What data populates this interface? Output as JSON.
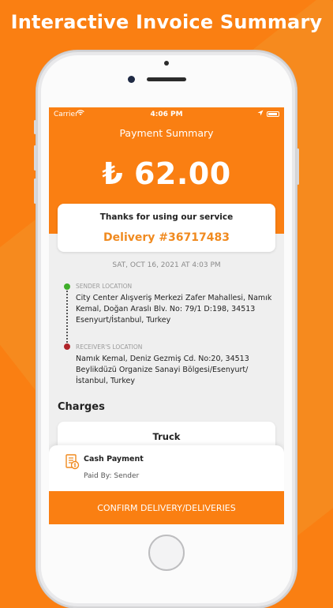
{
  "promo": {
    "title": "Interactive Invoice Summary"
  },
  "status_bar": {
    "carrier": "Carrier",
    "time": "4:06 PM"
  },
  "header": {
    "title": "Payment Summary",
    "amount": "₺ 62.00"
  },
  "thanks_card": {
    "message": "Thanks for using our service",
    "delivery_id": "Delivery #36717483"
  },
  "date": "SAT, OCT 16, 2021 AT 4:03 PM",
  "sender": {
    "label": "SENDER LOCATION",
    "address": "City Center Alışveriş Merkezi Zafer Mahallesi, Namık Kemal,  Doğan Araslı Blv. No: 79/1 D:198, 34513 Esenyurt/İstanbul,  Turkey"
  },
  "receiver": {
    "label": "RECEIVER'S LOCATION",
    "address": "Namık Kemal, Deniz Gezmiş Cd. No:20, 34513 Beylikdüzü Organize Sanayi Bölgesi/Esenyurt/İstanbul, Turkey"
  },
  "charges": {
    "title": "Charges",
    "vehicle": "Truck"
  },
  "payment": {
    "method": "Cash Payment",
    "paid_by": "Paid By: Sender"
  },
  "confirm_button": {
    "label": "CONFIRM DELIVERY/DELIVERIES"
  },
  "colors": {
    "brand_orange": "#FA7F12",
    "delivery_orange": "#F08A1F",
    "sender_green": "#3FAE2A",
    "receiver_red": "#B0242A"
  }
}
